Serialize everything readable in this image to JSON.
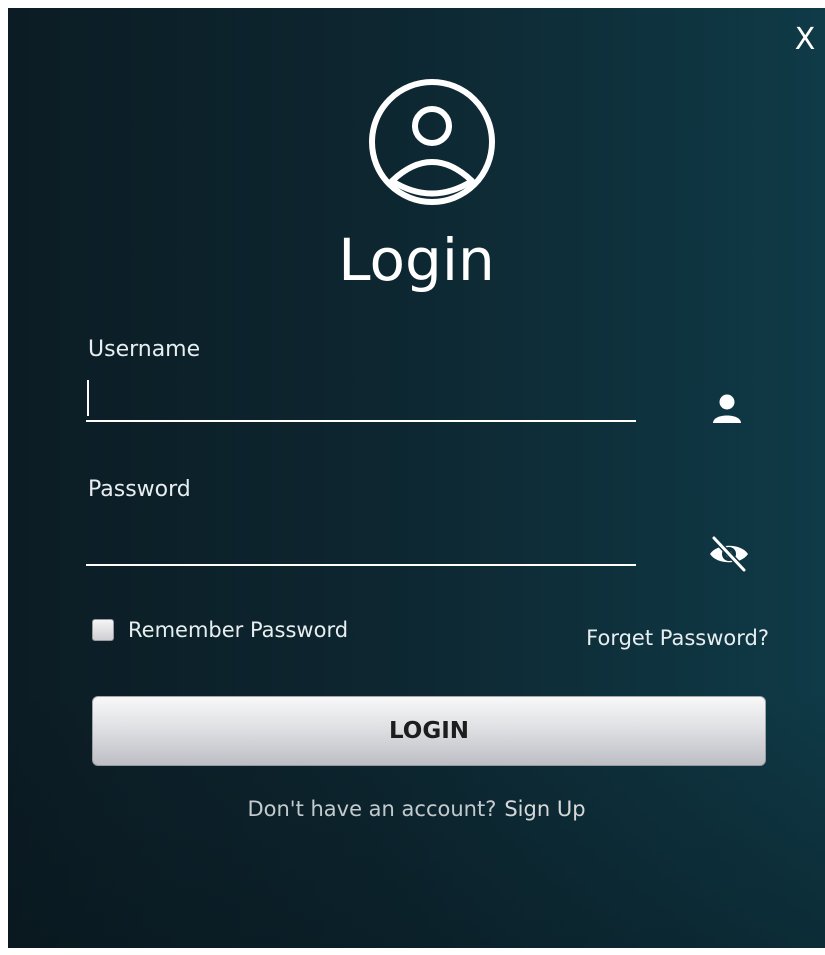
{
  "window": {
    "close_label": "X"
  },
  "title": "Login",
  "username": {
    "label": "Username",
    "value": "",
    "placeholder": ""
  },
  "password": {
    "label": "Password",
    "value": "",
    "placeholder": ""
  },
  "remember": {
    "label": "Remember Password",
    "checked": false
  },
  "forget_label": "Forget Password?",
  "login_label": "LOGIN",
  "signup": {
    "prompt": "Don't have an account?",
    "link": "Sign Up"
  },
  "icons": {
    "avatar": "user-circle-icon",
    "username": "user-icon",
    "password": "eye-slash-icon"
  },
  "colors": {
    "background_left": "#0c1c24",
    "background_right": "#0f3a47",
    "text": "#ffffff",
    "button_text": "#1e1e1e"
  }
}
